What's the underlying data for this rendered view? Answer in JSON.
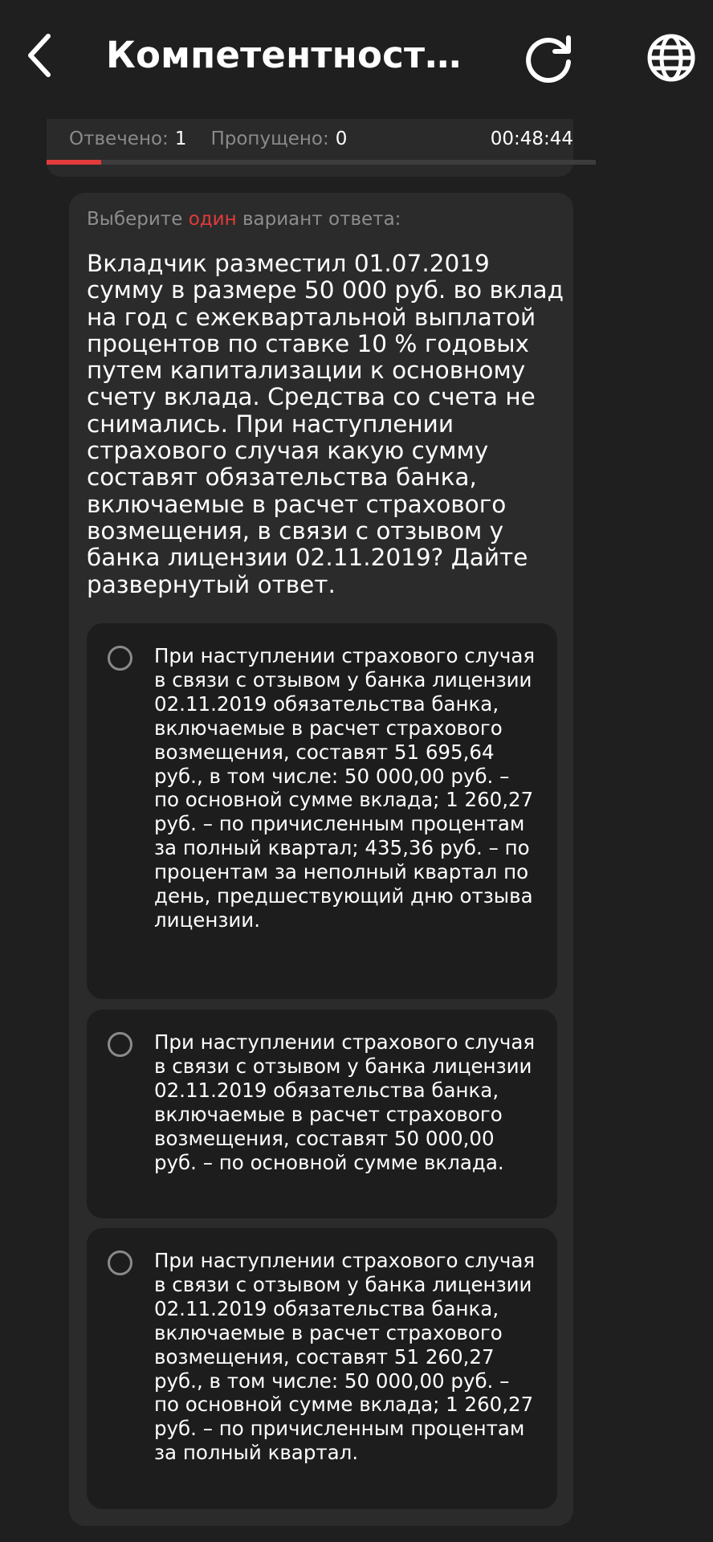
{
  "header": {
    "title": "Компетентностны...",
    "back_icon": "chevron-left-icon",
    "refresh_icon": "refresh-icon",
    "language_icon": "globe-icon"
  },
  "progress": {
    "answered_label": "Отвечено:",
    "answered_value": "1",
    "skipped_label": "Пропущено:",
    "skipped_value": "0",
    "timer": "00:48:44",
    "bar_fraction": 0.1,
    "bar_color": "#e23b3b"
  },
  "question": {
    "instruction_before": "Выберите ",
    "instruction_accent": "один",
    "instruction_after": " вариант ответа:",
    "text": "Вкладчик разместил 01.07.2019 сумму в размере 50 000 руб. во вклад на год с ежеквартальной выплатой процентов по ставке 10 % годовых путем капитализации к основному счету вклада. Средства со счета не снимались. При наступлении страхового случая какую сумму составят обязательства банка, включаемые в расчет страхового возмещения, в связи с отзывом у банка лицензии 02.11.2019? Дайте развернутый ответ."
  },
  "options": [
    {
      "text": "При наступлении страхового случая в связи с отзывом у банка лицензии 02.11.2019 обязательства банка, включаемые в расчет страхового возмещения, составят 51 695,64 руб., в том числе: 50 000,00 руб. – по основной сумме вклада; 1 260,27 руб. – по причисленным процентам за полный квартал; 435,36 руб. – по процентам за неполный квартал по день, предшествующий дню отзыва лицензии."
    },
    {
      "text": "При наступлении страхового случая в связи с отзывом у банка лицензии 02.11.2019 обязательства банка, включаемые в расчет страхового возмещения, составят 50 000,00 руб. – по основной сумме вклада."
    },
    {
      "text": "При наступлении страхового случая в связи с отзывом у банка лицензии 02.11.2019 обязательства банка, включаемые в расчет страхового возмещения, составят 51 260,27 руб., в том числе: 50 000,00 руб. – по основной сумме вклада; 1 260,27 руб. – по причисленным процентам за полный квартал."
    }
  ]
}
